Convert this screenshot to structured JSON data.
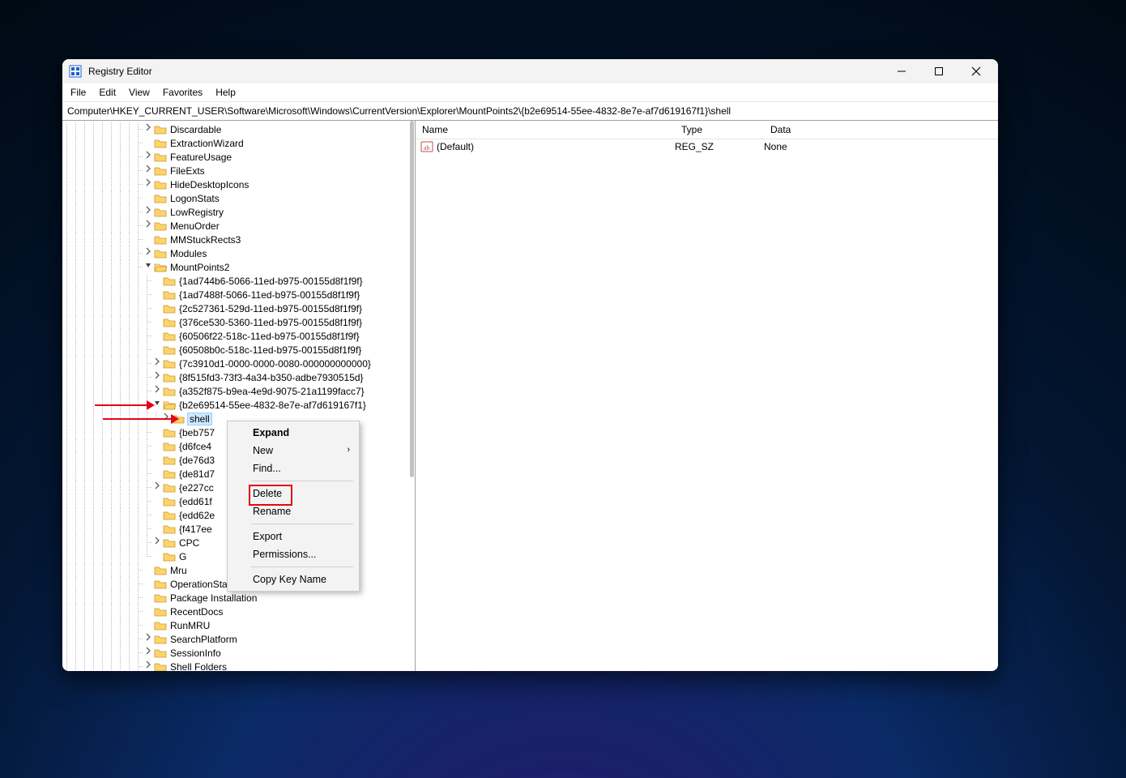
{
  "window": {
    "title": "Registry Editor"
  },
  "menu": [
    "File",
    "Edit",
    "View",
    "Favorites",
    "Help"
  ],
  "address": "Computer\\HKEY_CURRENT_USER\\Software\\Microsoft\\Windows\\CurrentVersion\\Explorer\\MountPoints2\\{b2e69514-55ee-4832-8e7e-af7d619167f1}\\shell",
  "tree": [
    {
      "indent": 9,
      "exp": ">",
      "label": "Discardable"
    },
    {
      "indent": 9,
      "exp": " ",
      "label": "ExtractionWizard"
    },
    {
      "indent": 9,
      "exp": ">",
      "label": "FeatureUsage"
    },
    {
      "indent": 9,
      "exp": ">",
      "label": "FileExts"
    },
    {
      "indent": 9,
      "exp": ">",
      "label": "HideDesktopIcons"
    },
    {
      "indent": 9,
      "exp": " ",
      "label": "LogonStats"
    },
    {
      "indent": 9,
      "exp": ">",
      "label": "LowRegistry"
    },
    {
      "indent": 9,
      "exp": ">",
      "label": "MenuOrder"
    },
    {
      "indent": 9,
      "exp": " ",
      "label": "MMStuckRects3"
    },
    {
      "indent": 9,
      "exp": ">",
      "label": "Modules"
    },
    {
      "indent": 9,
      "exp": "v",
      "label": "MountPoints2",
      "open": true
    },
    {
      "indent": 10,
      "exp": " ",
      "label": "{1ad744b6-5066-11ed-b975-00155d8f1f9f}"
    },
    {
      "indent": 10,
      "exp": " ",
      "label": "{1ad7488f-5066-11ed-b975-00155d8f1f9f}"
    },
    {
      "indent": 10,
      "exp": " ",
      "label": "{2c527361-529d-11ed-b975-00155d8f1f9f}"
    },
    {
      "indent": 10,
      "exp": " ",
      "label": "{376ce530-5360-11ed-b975-00155d8f1f9f}"
    },
    {
      "indent": 10,
      "exp": " ",
      "label": "{60506f22-518c-11ed-b975-00155d8f1f9f}"
    },
    {
      "indent": 10,
      "exp": " ",
      "label": "{60508b0c-518c-11ed-b975-00155d8f1f9f}"
    },
    {
      "indent": 10,
      "exp": ">",
      "label": "{7c3910d1-0000-0000-0080-000000000000}"
    },
    {
      "indent": 10,
      "exp": ">",
      "label": "{8f515fd3-73f3-4a34-b350-adbe7930515d}"
    },
    {
      "indent": 10,
      "exp": ">",
      "label": "{a352f875-b9ea-4e9d-9075-21a1199facc7}"
    },
    {
      "indent": 10,
      "exp": "v",
      "label": "{b2e69514-55ee-4832-8e7e-af7d619167f1}",
      "open": true,
      "arrow": 1
    },
    {
      "indent": 11,
      "exp": ">",
      "label": "shell",
      "selected": true,
      "arrow": 2,
      "last": true
    },
    {
      "indent": 10,
      "exp": " ",
      "label": "{beb757"
    },
    {
      "indent": 10,
      "exp": " ",
      "label": "{d6fce4"
    },
    {
      "indent": 10,
      "exp": " ",
      "label": "{de76d3"
    },
    {
      "indent": 10,
      "exp": " ",
      "label": "{de81d7"
    },
    {
      "indent": 10,
      "exp": ">",
      "label": "{e227cc"
    },
    {
      "indent": 10,
      "exp": " ",
      "label": "{edd61f"
    },
    {
      "indent": 10,
      "exp": " ",
      "label": "{edd62e"
    },
    {
      "indent": 10,
      "exp": " ",
      "label": "{f417ee"
    },
    {
      "indent": 10,
      "exp": ">",
      "label": "CPC"
    },
    {
      "indent": 10,
      "exp": " ",
      "label": "G",
      "last": true
    },
    {
      "indent": 9,
      "exp": " ",
      "label": "Mru"
    },
    {
      "indent": 9,
      "exp": " ",
      "label": "OperationStatusManager"
    },
    {
      "indent": 9,
      "exp": " ",
      "label": "Package Installation"
    },
    {
      "indent": 9,
      "exp": " ",
      "label": "RecentDocs"
    },
    {
      "indent": 9,
      "exp": " ",
      "label": "RunMRU"
    },
    {
      "indent": 9,
      "exp": ">",
      "label": "SearchPlatform"
    },
    {
      "indent": 9,
      "exp": ">",
      "label": "SessionInfo"
    },
    {
      "indent": 9,
      "exp": ">",
      "label": "Shell Folders"
    }
  ],
  "list": {
    "headers": {
      "name": "Name",
      "type": "Type",
      "data": "Data"
    },
    "rows": [
      {
        "name": "(Default)",
        "type": "REG_SZ",
        "data": "None"
      }
    ]
  },
  "context_menu": [
    {
      "label": "Expand",
      "bold": true
    },
    {
      "label": "New",
      "submenu": true
    },
    {
      "label": "Find..."
    },
    {
      "sep": true
    },
    {
      "label": "Delete",
      "highlight": true
    },
    {
      "label": "Rename"
    },
    {
      "sep": true
    },
    {
      "label": "Export"
    },
    {
      "label": "Permissions..."
    },
    {
      "sep": true
    },
    {
      "label": "Copy Key Name"
    }
  ]
}
